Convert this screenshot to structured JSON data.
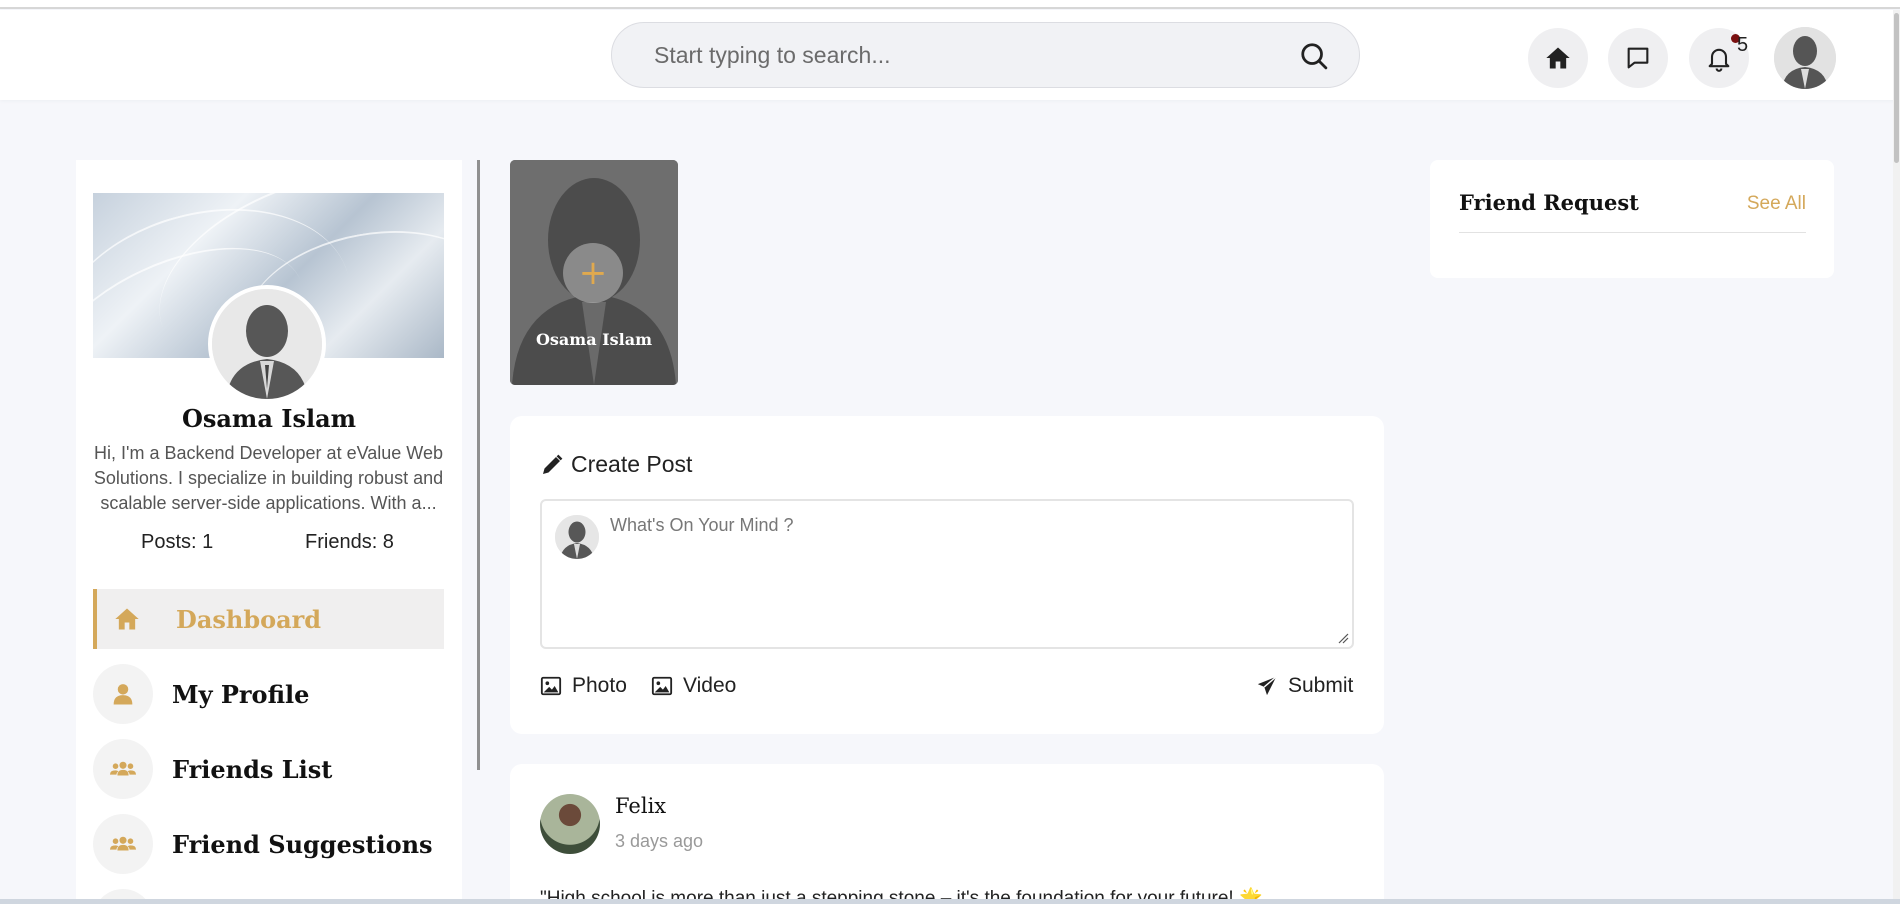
{
  "header": {
    "search": {
      "placeholder": "Start typing to search..."
    },
    "notifications": {
      "count": "5"
    }
  },
  "sidebar": {
    "profile": {
      "name": "Osama Islam",
      "bio": "Hi, I'm a Backend Developer at eValue Web Solutions. I specialize in building robust and scalable server-side applications. With a...",
      "posts": "Posts: 1",
      "friends": "Friends: 8"
    },
    "nav": [
      {
        "label": "Dashboard",
        "icon": "home-icon",
        "active": true
      },
      {
        "label": "My Profile",
        "icon": "user-icon"
      },
      {
        "label": "Friends List",
        "icon": "users-icon"
      },
      {
        "label": "Friend Suggestions",
        "icon": "users-icon"
      }
    ]
  },
  "story": {
    "name": "Osama Islam",
    "add_label": "+"
  },
  "create_post": {
    "title": "Create Post",
    "placeholder": "What's On Your Mind ?",
    "photo_label": "Photo",
    "video_label": "Video",
    "submit_label": "Submit"
  },
  "feed": {
    "posts": [
      {
        "author": "Felix",
        "time": "3 days ago",
        "text": "\"High school is more than just a stepping stone – it's the foundation for your future! 🌟"
      }
    ]
  },
  "friend_requests": {
    "title": "Friend Request",
    "see_all": "See All"
  },
  "colors": {
    "accent": "#d4a85a",
    "background": "#f6f7fb"
  }
}
